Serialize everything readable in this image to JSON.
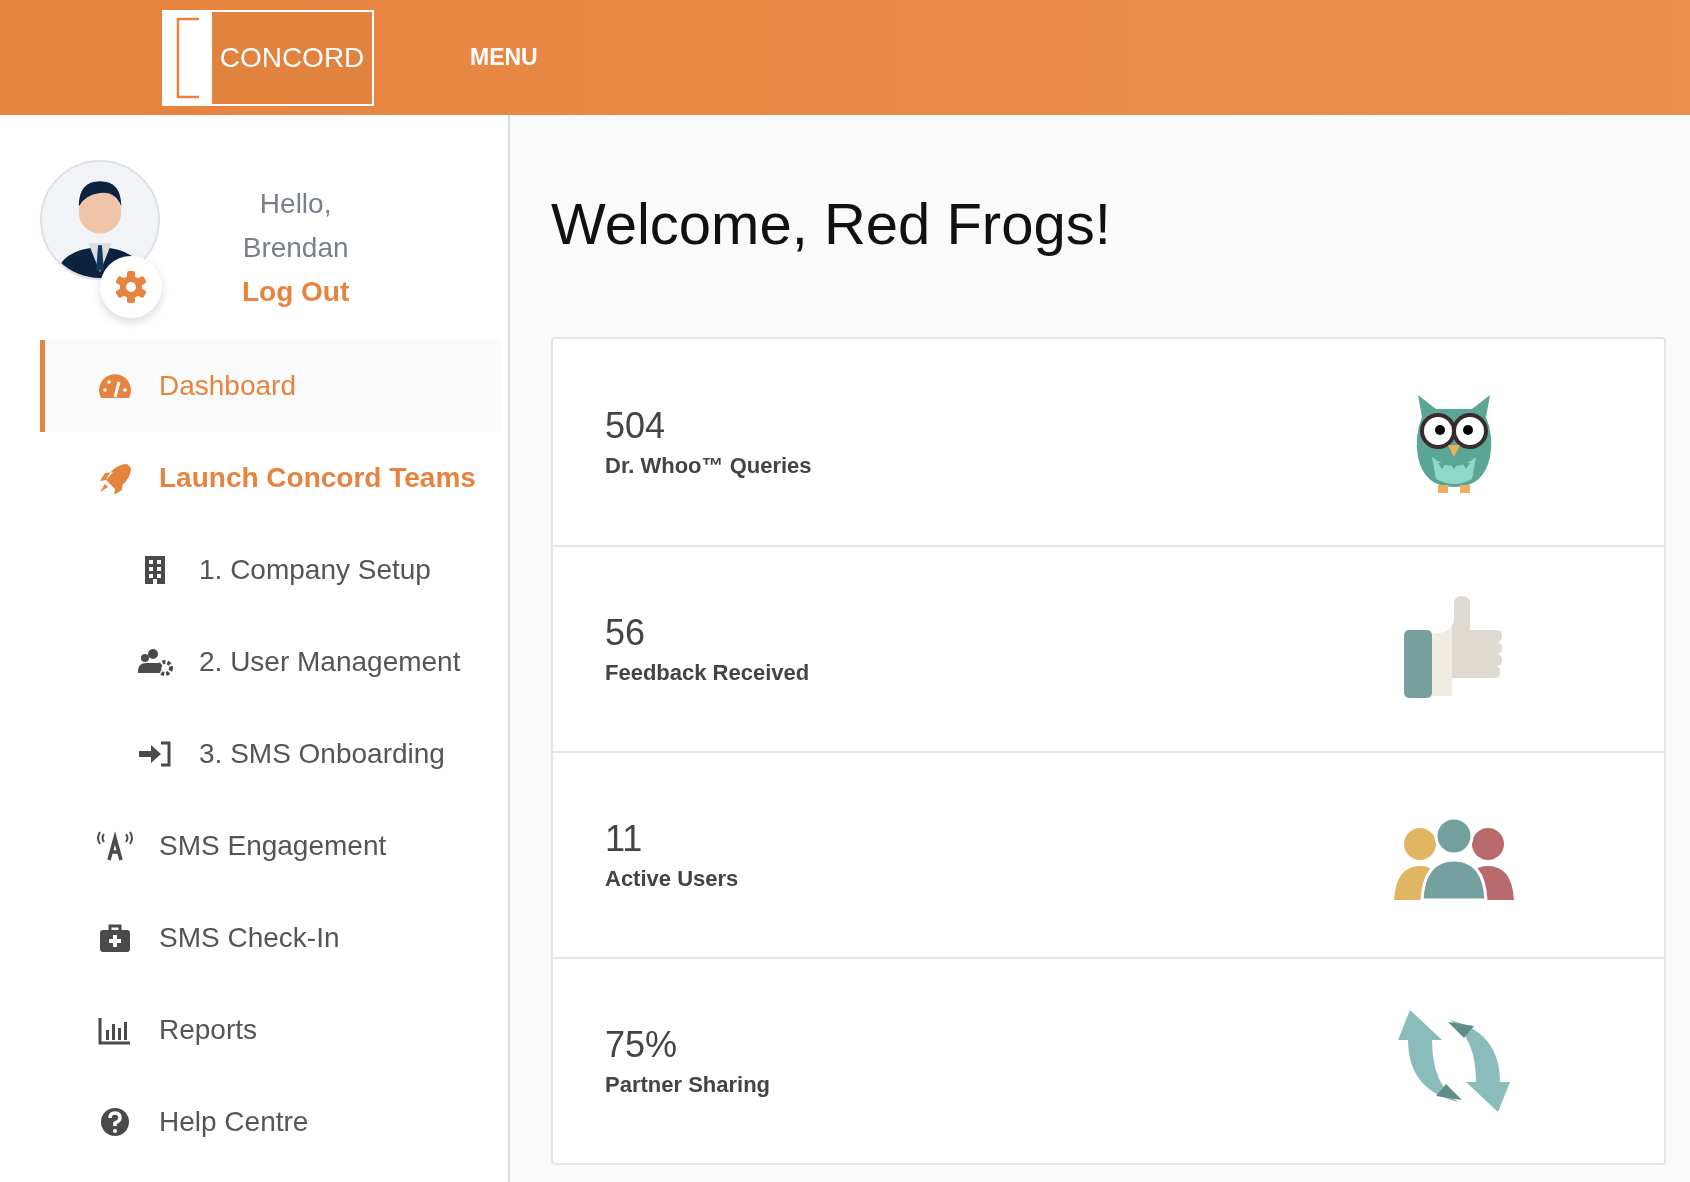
{
  "header": {
    "logo": "CONCORD",
    "menu": "MENU"
  },
  "profile": {
    "greeting": "Hello,",
    "name": "Brendan",
    "logout": "Log Out"
  },
  "nav": [
    {
      "label": "Dashboard",
      "kind": "gauge",
      "selected": true
    },
    {
      "label": "Launch Concord Teams",
      "kind": "rocket",
      "selected": false,
      "expanded": true,
      "children": [
        {
          "label": "1. Company Setup",
          "kind": "building",
          "selected": false
        },
        {
          "label": "2. User Management",
          "kind": "users",
          "selected": false
        },
        {
          "label": "3. SMS Onboarding",
          "kind": "signin",
          "selected": false
        }
      ]
    },
    {
      "label": "SMS Engagement",
      "kind": "antenna",
      "selected": false
    },
    {
      "label": "SMS Check-In",
      "kind": "medkit",
      "selected": false
    },
    {
      "label": "Reports",
      "kind": "chart",
      "selected": false
    },
    {
      "label": "Help Centre",
      "kind": "help",
      "selected": false
    }
  ],
  "main": {
    "title": "Welcome, Red Frogs!"
  },
  "cards": [
    {
      "value": "504",
      "label": "Dr. Whoo™ Queries",
      "kind": "owl"
    },
    {
      "value": "56",
      "label": "Feedback Received",
      "kind": "thumb"
    },
    {
      "value": "11",
      "label": "Active Users",
      "kind": "people"
    },
    {
      "value": "75%",
      "label": "Partner Sharing",
      "kind": "cycle"
    }
  ]
}
